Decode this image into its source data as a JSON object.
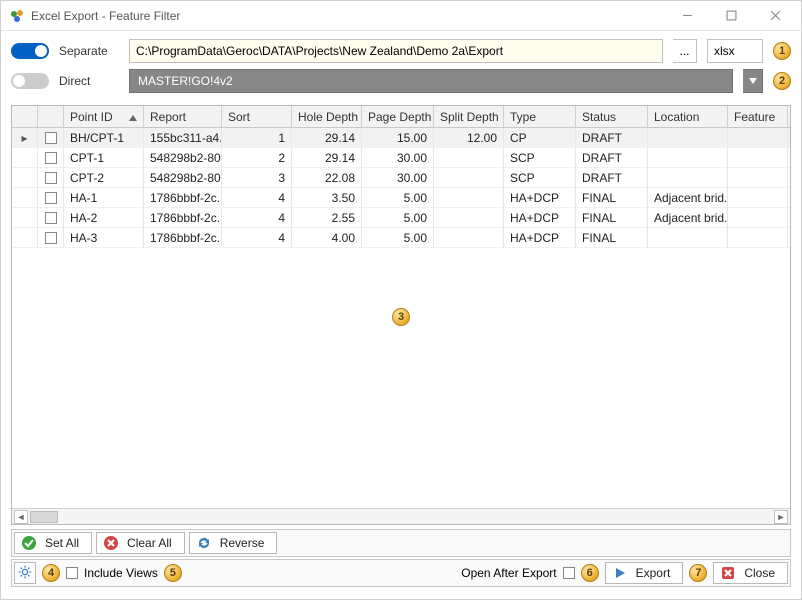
{
  "window": {
    "title": "Excel Export - Feature Filter"
  },
  "top": {
    "separate_label": "Separate",
    "direct_label": "Direct",
    "path": "C:\\ProgramData\\Geroc\\DATA\\Projects\\New Zealand\\Demo 2a\\Export",
    "ellipsis": "...",
    "ext": "xlsx",
    "template": "MASTER!GO!4v2"
  },
  "badges": {
    "b1": "1",
    "b2": "2",
    "b3": "3",
    "b4": "4",
    "b5": "5",
    "b6": "6",
    "b7": "7"
  },
  "grid": {
    "columns": {
      "point_id": "Point ID",
      "report": "Report",
      "sort": "Sort",
      "hole_depth": "Hole Depth",
      "page_depth": "Page Depth",
      "split_depth": "Split Depth",
      "type": "Type",
      "status": "Status",
      "location": "Location",
      "feature": "Feature"
    },
    "rows": [
      {
        "sel": true,
        "point_id": "BH/CPT-1",
        "report": "155bc311-a4...",
        "sort": "1",
        "hole_depth": "29.14",
        "page_depth": "15.00",
        "split_depth": "12.00",
        "type": "CP",
        "status": "DRAFT",
        "location": "",
        "feature": ""
      },
      {
        "point_id": "CPT-1",
        "report": "548298b2-80...",
        "sort": "2",
        "hole_depth": "29.14",
        "page_depth": "30.00",
        "split_depth": "",
        "type": "SCP",
        "status": "DRAFT",
        "location": "",
        "feature": ""
      },
      {
        "point_id": "CPT-2",
        "report": "548298b2-80...",
        "sort": "3",
        "hole_depth": "22.08",
        "page_depth": "30.00",
        "split_depth": "",
        "type": "SCP",
        "status": "DRAFT",
        "location": "",
        "feature": ""
      },
      {
        "point_id": "HA-1",
        "report": "1786bbbf-2c...",
        "sort": "4",
        "hole_depth": "3.50",
        "page_depth": "5.00",
        "split_depth": "",
        "type": "HA+DCP",
        "status": "FINAL",
        "location": "Adjacent brid...",
        "feature": ""
      },
      {
        "point_id": "HA-2",
        "report": "1786bbbf-2c...",
        "sort": "4",
        "hole_depth": "2.55",
        "page_depth": "5.00",
        "split_depth": "",
        "type": "HA+DCP",
        "status": "FINAL",
        "location": "Adjacent brid...",
        "feature": ""
      },
      {
        "point_id": "HA-3",
        "report": "1786bbbf-2c...",
        "sort": "4",
        "hole_depth": "4.00",
        "page_depth": "5.00",
        "split_depth": "",
        "type": "HA+DCP",
        "status": "FINAL",
        "location": "",
        "feature": ""
      }
    ]
  },
  "buttons": {
    "set_all": "Set All",
    "clear_all": "Clear All",
    "reverse": "Reverse",
    "include_views": "Include Views",
    "open_after": "Open After Export",
    "export": "Export",
    "close": "Close"
  }
}
